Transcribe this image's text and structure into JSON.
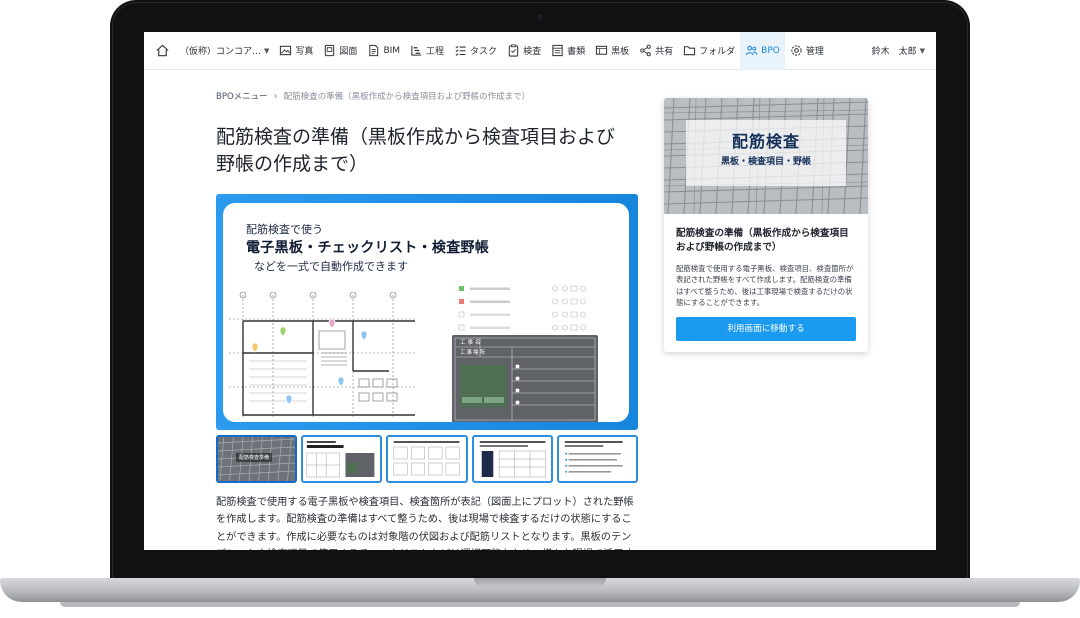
{
  "nav": {
    "project": "（仮称）コンコア…",
    "items": [
      {
        "label": "写真",
        "icon": "photo-icon"
      },
      {
        "label": "図面",
        "icon": "drawing-icon"
      },
      {
        "label": "BIM",
        "icon": "bim-icon"
      },
      {
        "label": "工程",
        "icon": "schedule-icon"
      },
      {
        "label": "タスク",
        "icon": "task-icon"
      },
      {
        "label": "検査",
        "icon": "inspection-icon"
      },
      {
        "label": "書類",
        "icon": "document-icon"
      },
      {
        "label": "黒板",
        "icon": "blackboard-icon"
      },
      {
        "label": "共有",
        "icon": "share-icon"
      },
      {
        "label": "フォルダ",
        "icon": "folder-icon"
      },
      {
        "label": "BPO",
        "icon": "bpo-icon",
        "active": true
      },
      {
        "label": "管理",
        "icon": "gear-icon"
      }
    ],
    "user": "鈴木　太郎"
  },
  "breadcrumb": {
    "root": "BPOメニュー",
    "current": "配筋検査の準備（黒板作成から検査項目および野帳の作成まで）"
  },
  "page_title": "配筋検査の準備（黒板作成から検査項目および野帳の作成まで）",
  "hero": {
    "line1": "配筋検査で使う",
    "line2": "電子黒板・チェックリスト・検査野帳",
    "line3": "などを一式で自動作成できます",
    "board_row1": "工事名",
    "board_row2": "工事場所"
  },
  "thumbnails": {
    "first_caption": "配筋検査準備"
  },
  "description": "配筋検査で使用する電子黒板や検査項目、検査箇所が表記（図面上にプロット）された野帳を作成します。配筋検査の準備はすべて整うため、後は現場で検査するだけの状態にすることができます。作成に必要なものは対象階の伏図および配筋リストとなります。黒板のテンプレートや検査項目で使用するチェックリストなどは選択可能なため、様々な現場で活用す",
  "side_card": {
    "banner_title": "配筋検査",
    "banner_subtitle": "黒板・検査項目・野帳",
    "title": "配筋検査の準備（黒板作成から検査項目および野帳の作成まで）",
    "description": "配筋検査で使用する電子黒板、検査項目、検査箇所が表記された野帳をすべて作成します。配筋検査の準備はすべて整うため、後は工事現場で検査するだけの状態にすることができます。",
    "button_label": "利用画面に移動する"
  },
  "colors": {
    "accent": "#1a9bef",
    "active_nav": "#1d88db",
    "hero_frame": "#1b8fe6"
  }
}
